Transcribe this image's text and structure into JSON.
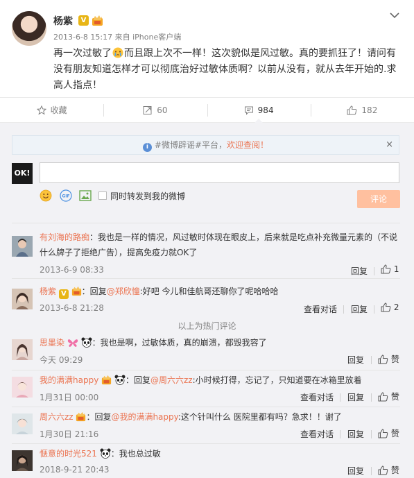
{
  "post": {
    "user_name": "杨紫",
    "meta": "2013-6-8 15:17 来自 iPhone客户端",
    "text_before_emoji": "再一次过敏了",
    "text_after_emoji": "而且跟上次不一样！这次貌似是风过敏。真的要抓狂了！请问有没有朋友知道怎样才可以彻底治好过敏体质啊？以前从没有，就从去年开始的.求高人指点！",
    "v_badge": "V"
  },
  "actions": {
    "favorite": "收藏",
    "repost": "60",
    "comment": "984",
    "like": "182"
  },
  "notice": {
    "text": "#微博辟谣#平台，",
    "link": "欢迎查阅！",
    "close": "×"
  },
  "compose": {
    "avatar_text": "OK!",
    "repost_label": "同时转发到我的微博",
    "submit": "评论"
  },
  "hot_divider": "以上为热门评论",
  "labels": {
    "reply": "回复",
    "view_thread": "查看对话",
    "praise": "赞"
  },
  "comments": [
    {
      "user": "有刘海的路痴",
      "text_l1": "：我也是一样的情况，风过敏时体现在眼皮上，后来就是吃点补充微量元素的（不说",
      "text_l2": "什么牌子了拒绝广告），提高免疫力就OK了",
      "time": "2013-6-9 08:33",
      "likes": "1"
    },
    {
      "user": "杨紫",
      "prefix": "：回复",
      "mention": "@郑欣憧",
      "text": ":好吧 今儿和佳航哥还聊你了呢哈哈哈",
      "time": "2013-6-8 21:28",
      "likes": "2"
    },
    {
      "user": "思墨染",
      "text": "：我也是啊，过敏体质，真的崩溃，都毁我容了",
      "time": "今天 09:29"
    },
    {
      "user": "我的满满happy",
      "prefix": "：回复",
      "mention": "@周六六zz",
      "text": ":小时候打得，忘记了，只知道要在冰箱里放着",
      "time": "1月31日 00:00"
    },
    {
      "user": "周六六zz",
      "prefix": "：回复",
      "mention": "@我的满满happy",
      "text": ":这个针叫什么 医院里都有吗？急求！！谢了",
      "time": "1月30日 21:16"
    },
    {
      "user": "惬意的时光521",
      "text": "：我也总过敏",
      "time": "2018-9-21 20:43"
    }
  ],
  "colors": {
    "accent": "#eb7350",
    "page_bg": "#f2f2f5",
    "submit_bg": "#ffc09f",
    "vip_gold": "#e8b516"
  }
}
